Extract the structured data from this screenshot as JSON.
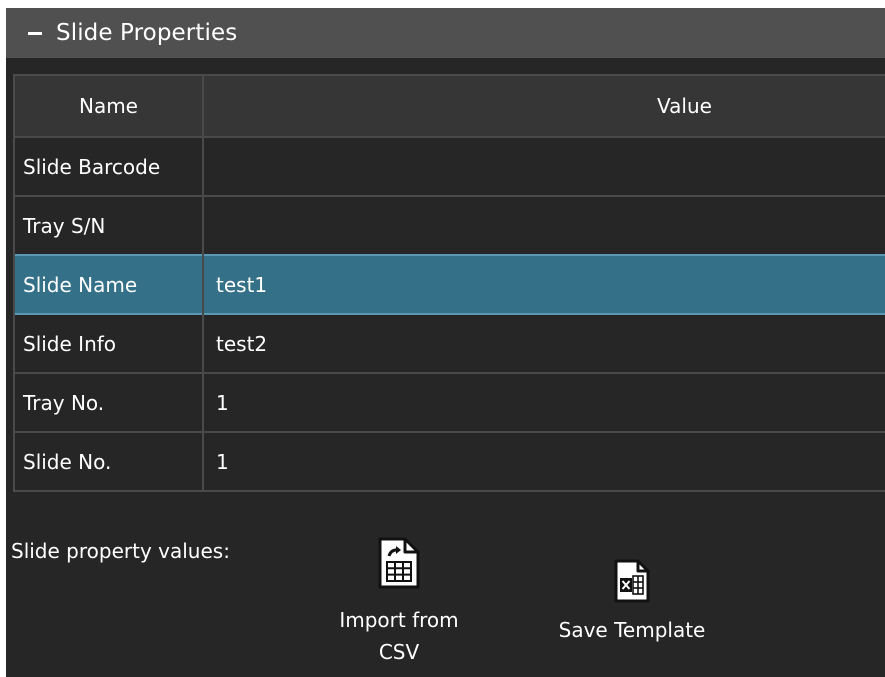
{
  "header": {
    "title": "Slide Properties"
  },
  "grid": {
    "columns": [
      "Name",
      "Value"
    ],
    "rows": [
      {
        "name": "Slide Barcode",
        "value": ""
      },
      {
        "name": "Tray S/N",
        "value": ""
      },
      {
        "name": "Slide Name",
        "value": "test1",
        "selected": true
      },
      {
        "name": "Slide Info",
        "value": "test2"
      },
      {
        "name": "Tray No.",
        "value": "1"
      },
      {
        "name": "Slide No.",
        "value": "1"
      }
    ]
  },
  "footer": {
    "label": "Slide property values:",
    "import_label_line1": "Import from",
    "import_label_line2": "CSV",
    "save_label": "Save Template",
    "import_icon": "csv-import-icon",
    "save_icon": "excel-file-icon"
  },
  "colors": {
    "panel_bg": "#262626",
    "header_bg": "#505050",
    "selected_row": "#357089"
  }
}
